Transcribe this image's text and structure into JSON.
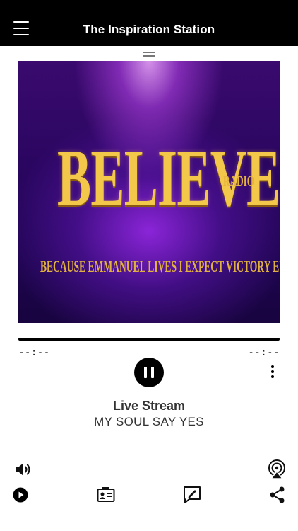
{
  "header": {
    "title": "The Inspiration Station",
    "menu_icon": "hamburger-menu-icon"
  },
  "artwork": {
    "logo_text": "BELIEVE",
    "logo_sub": "RADIO",
    "tagline": "BECAUSE EMMANUEL LIVES I EXPECT VICTORY EVERYTIME"
  },
  "player": {
    "elapsed": "--:--",
    "remaining": "--:--",
    "state": "playing",
    "stream_label": "Live Stream",
    "track": "MY SOUL SAY YES"
  },
  "controls": {
    "volume_icon": "volume-icon",
    "airplay_icon": "airplay-icon",
    "more_icon": "more-vertical-icon"
  },
  "bottom_bar": {
    "items": [
      "play-icon",
      "contact-card-icon",
      "compose-icon",
      "share-icon"
    ]
  },
  "colors": {
    "header_bg": "#000000",
    "accent": "#000000",
    "logo_gold": "#f2c74a",
    "artwork_purple": "#3a0a6e"
  }
}
